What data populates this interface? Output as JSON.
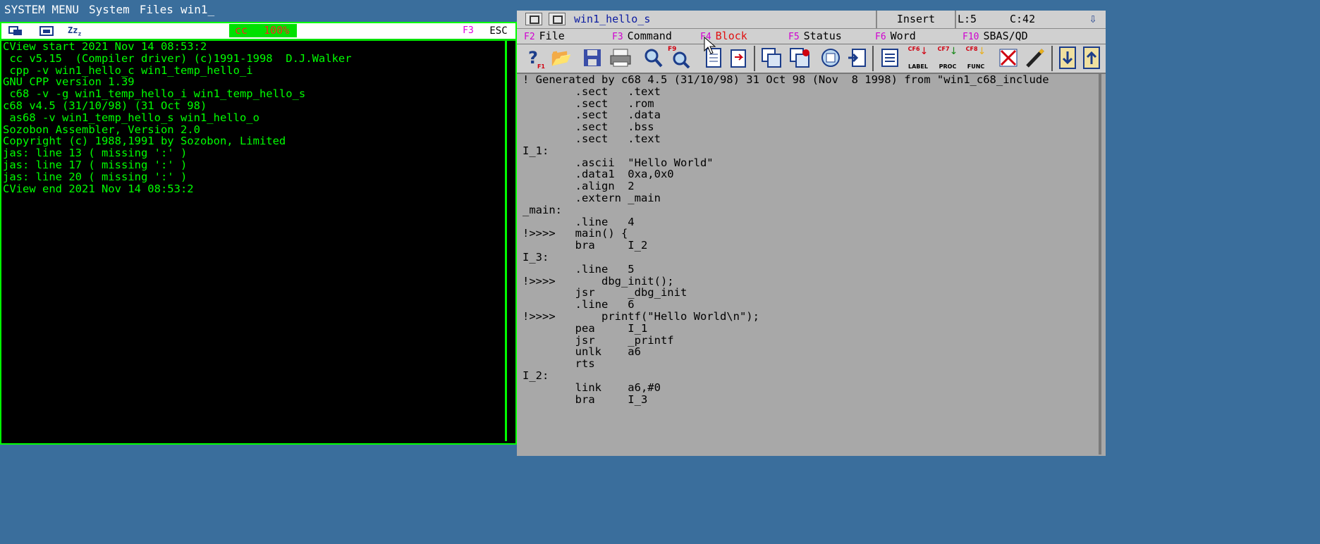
{
  "topbar": {
    "system_menu": "SYSTEM MENU",
    "system": "System",
    "files": "Files",
    "win": "win1_"
  },
  "left": {
    "zoom_cmd": "cc",
    "zoom_pct": "100%",
    "f3": "F3",
    "esc": "ESC",
    "lines": [
      "CView start 2021 Nov 14 08:53:2",
      " cc v5.15  (Compiler driver) (c)1991-1998  D.J.Walker",
      " cpp -v win1_hello_c win1_temp_hello_i",
      "GNU CPP version 1.39",
      " c68 -v -g win1_temp_hello_i win1_temp_hello_s",
      "c68 v4.5 (31/10/98) (31 Oct 98)",
      " as68 -v win1_temp_hello_s win1_hello_o",
      "Sozobon Assembler, Version 2.0",
      "Copyright (c) 1988,1991 by Sozobon, Limited",
      "jas: line 13 ( missing ':' )",
      "jas: line 17 ( missing ':' )",
      "jas: line 20 ( missing ':' )",
      "CView end 2021 Nov 14 08:53:2"
    ]
  },
  "right": {
    "filename": "win1_hello_s",
    "mode": "Insert",
    "line": "L:5",
    "col": "C:42",
    "menu": [
      {
        "key": "F2",
        "label": "File"
      },
      {
        "key": "F3",
        "label": "Command"
      },
      {
        "key": "F4",
        "label": "Block"
      },
      {
        "key": "F5",
        "label": "Status"
      },
      {
        "key": "F6",
        "label": "Word"
      },
      {
        "key": "F10",
        "label": "SBAS/QD"
      }
    ],
    "tool_labels": {
      "help": "F1",
      "find": "F9",
      "label": "LABEL",
      "label_key": "CF6",
      "proc": "PROC",
      "proc_key": "CF7",
      "func": "FUNC",
      "func_key": "CF8"
    },
    "lines": [
      "! Generated by c68 4.5 (31/10/98) 31 Oct 98 (Nov  8 1998) from \"win1_c68_include",
      "        .sect   .text",
      "        .sect   .rom",
      "        .sect   .data",
      "        .sect   .bss",
      "        .sect   .text",
      "I_1:",
      "        .ascii  \"Hello World\"",
      "        .data1  0xa,0x0",
      "        .align  2",
      "        .extern _main",
      "_main:",
      "        .line   4",
      "!>>>>   main() {",
      "        bra     I_2",
      "I_3:",
      "        .line   5",
      "!>>>>       dbg_init();",
      "        jsr     _dbg_init",
      "        .line   6",
      "!>>>>       printf(\"Hello World\\n\");",
      "        pea     I_1",
      "        jsr     _printf",
      "        unlk    a6",
      "        rts",
      "I_2:",
      "        link    a6,#0",
      "        bra     I_3"
    ]
  },
  "colors": {
    "terminal_text": "#00ff00",
    "terminal_bg": "#000000",
    "editor_bg": "#a8a8a8",
    "desktop": "#3a6e9c"
  }
}
